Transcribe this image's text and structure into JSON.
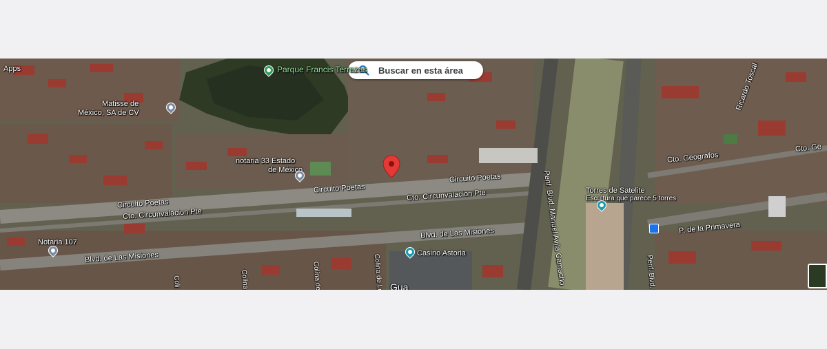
{
  "search": {
    "label": "Buscar en esta área"
  },
  "places": {
    "park": "Parque Francis Terrazas",
    "apps": "Apps",
    "matisse_line1": "Matisse de",
    "matisse_line2": "México, SA de CV",
    "notaria33_line1": "notaria 33 Estado",
    "notaria33_line2": "de México",
    "torres_line1": "Torres de Satelite",
    "torres_line2": "Escultura que parece 5 torres",
    "notaria107": "Notaria 107",
    "casino": "Casino Astoria"
  },
  "streets": {
    "circuito_poetas_1": "Circuito Poetas",
    "circuito_poetas_2": "Circuito Poetas",
    "circuito_poetas_3": "Circuito Poetas",
    "circunvalacion_1": "Cto. Circunvalacion Pte",
    "circunvalacion_2": "Cto. Circunvalacion Pte",
    "misiones_1": "Blvd. de Las Misiones",
    "misiones_2": "Blvd. de Las Misiones",
    "periferico": "Perif. Blvd. Manuel Avila Camacho",
    "geografos": "Cto. Geografos",
    "geo_partial": "Cto. Ge",
    "primavera": "P. de la Primavera",
    "ricardo": "Ricardo Toscal",
    "colina": "Colina de Lo",
    "colina2": "Colina de",
    "colina3": "Colina",
    "colina4": "Coli",
    "bottom_mark": "Gua",
    "perif_east": "Perif. Blvd. Ma"
  },
  "colors": {
    "poi_green": "#2e9e5a",
    "poi_teal": "#1a9bb0",
    "poi_gray": "#7b8aa0",
    "marker_red": "#e53935",
    "search_icon": "#1a73e8"
  }
}
